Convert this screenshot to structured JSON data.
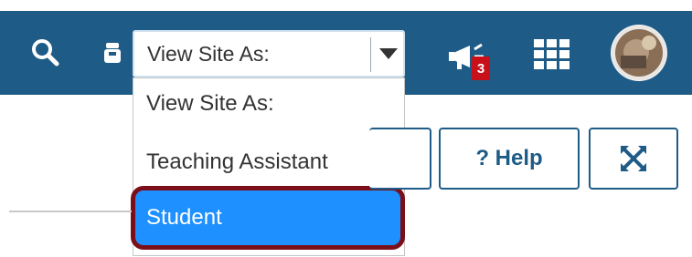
{
  "topbar": {
    "bg_color": "#1e5b86",
    "search_icon": "search-icon",
    "role_icon": "role-switch-icon",
    "notifications_icon": "megaphone-icon",
    "notifications_count": "3",
    "apps_icon": "grid-icon",
    "avatar_icon": "user-avatar"
  },
  "view_site_as": {
    "selected_label": "View Site As:",
    "options": [
      "View Site As:",
      "Teaching Assistant",
      "Student"
    ],
    "highlighted_option": "Student",
    "highlight_color": "#1e90ff",
    "callout_color": "#7a0f1a"
  },
  "toolbar": {
    "help_label": "? Help",
    "expand_icon": "expand-icon"
  }
}
